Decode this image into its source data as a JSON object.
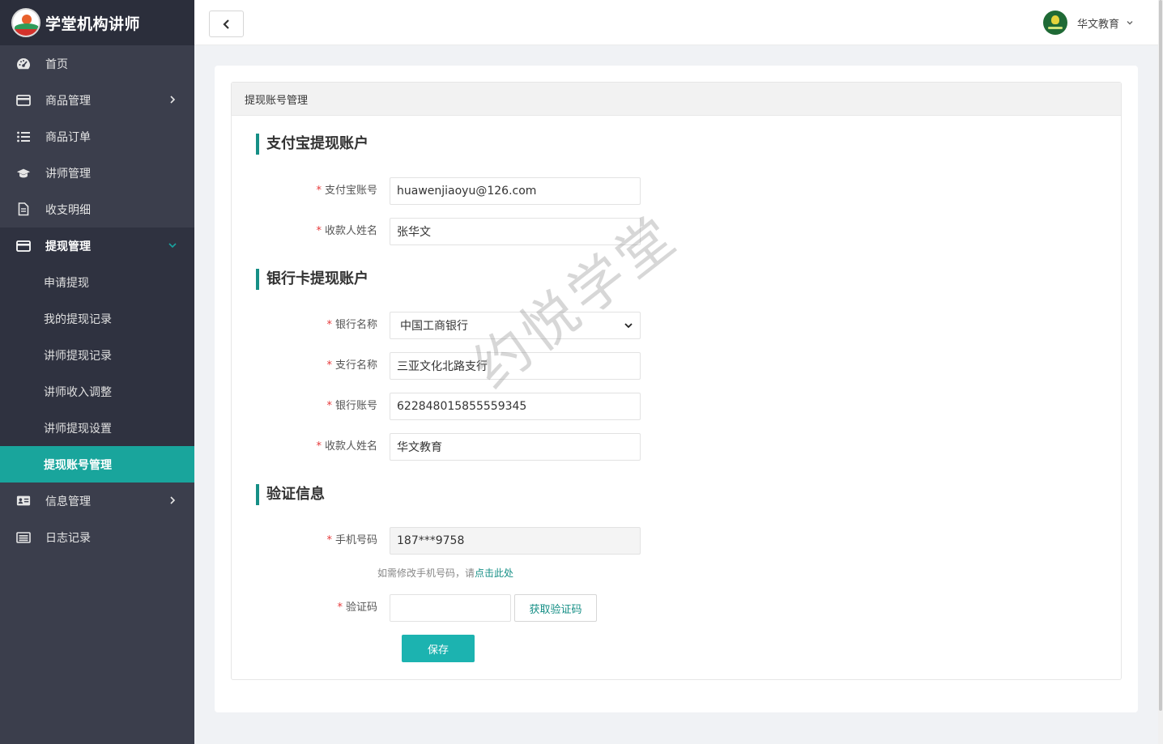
{
  "app": {
    "title": "学堂机构讲师"
  },
  "sidebar": {
    "items": [
      {
        "label": "首页",
        "icon": "dashboard-icon"
      },
      {
        "label": "商品管理",
        "icon": "card-icon",
        "has_children": true
      },
      {
        "label": "商品订单",
        "icon": "list-icon"
      },
      {
        "label": "讲师管理",
        "icon": "graduation-cap-icon"
      },
      {
        "label": "收支明细",
        "icon": "document-icon"
      },
      {
        "label": "提现管理",
        "icon": "card-icon",
        "has_children": true,
        "expanded": true
      },
      {
        "label": "信息管理",
        "icon": "id-card-icon",
        "has_children": true
      },
      {
        "label": "日志记录",
        "icon": "log-icon"
      }
    ],
    "sub_items": [
      {
        "label": "申请提现"
      },
      {
        "label": "我的提现记录"
      },
      {
        "label": "讲师提现记录"
      },
      {
        "label": "讲师收入调整"
      },
      {
        "label": "讲师提现设置"
      },
      {
        "label": "提现账号管理",
        "active": true
      }
    ]
  },
  "header": {
    "user_name": "华文教育"
  },
  "panel": {
    "title": "提现账号管理",
    "alipay": {
      "section_title": "支付宝提现账户",
      "account_label": "支付宝账号",
      "account_value": "huawenjiaoyu@126.com",
      "payee_label": "收款人姓名",
      "payee_value": "张华文"
    },
    "bank": {
      "section_title": "银行卡提现账户",
      "bank_label": "银行名称",
      "bank_value": "中国工商银行",
      "branch_label": "支行名称",
      "branch_value": "三亚文化北路支行",
      "card_label": "银行账号",
      "card_value": "6228480158555593​45",
      "payee_label": "收款人姓名",
      "payee_value": "华文教育"
    },
    "verify": {
      "section_title": "验证信息",
      "phone_label": "手机号码",
      "phone_value": "187***9758",
      "hint_text": "如需修改手机号码，请",
      "hint_link": "点击此处",
      "code_label": "验证码",
      "code_value": "",
      "code_button": "获取验证码",
      "save_button": "保存"
    }
  },
  "watermark": "约悦学堂",
  "colors": {
    "sidebar_bg": "#3b3e4c",
    "accent": "#19a59c",
    "button": "#1cb3b0",
    "required": "#e6393b"
  }
}
